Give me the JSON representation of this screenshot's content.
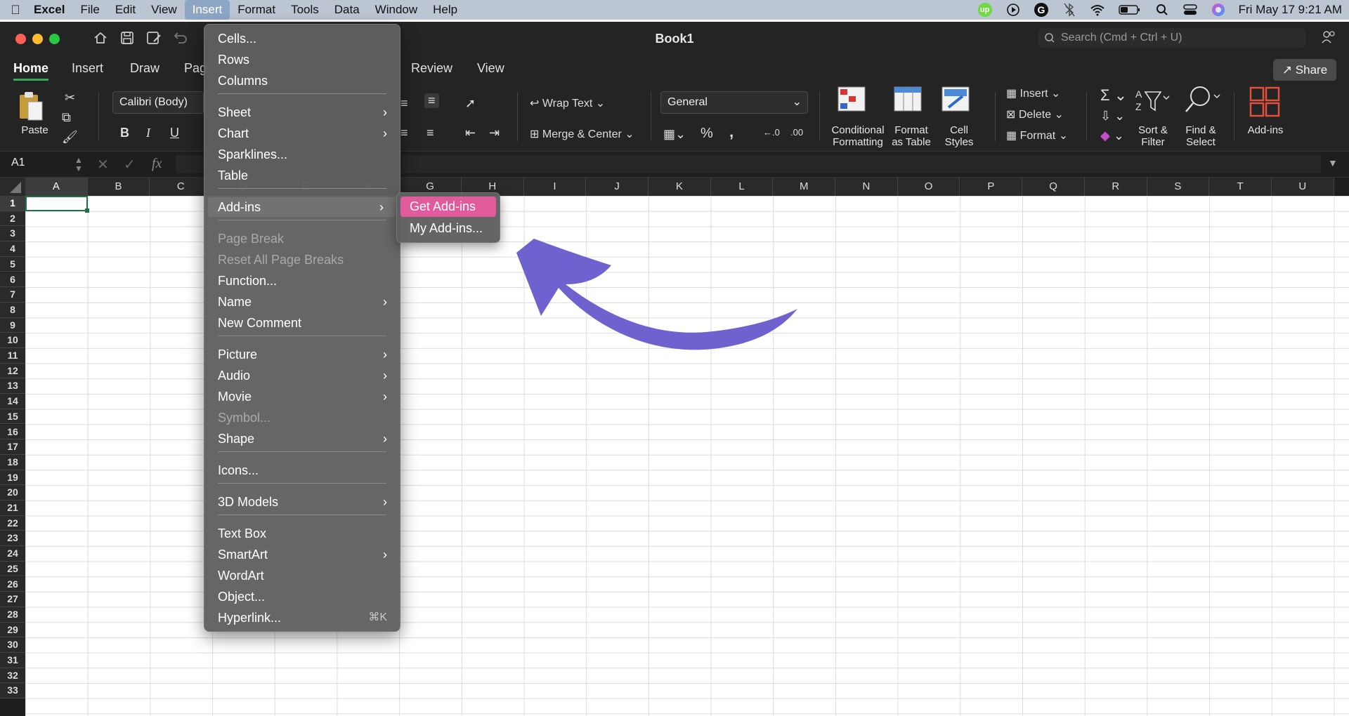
{
  "menubar": {
    "app": "Excel",
    "items": [
      "File",
      "Edit",
      "View",
      "Insert",
      "Format",
      "Tools",
      "Data",
      "Window",
      "Help"
    ],
    "active_item": "Insert",
    "clock": "Fri May 17  9:21 AM",
    "status_icons": [
      "upwork-icon",
      "play-icon",
      "grammarly-icon",
      "bluetooth-icon",
      "wifi-icon",
      "battery-icon",
      "search-icon",
      "control-center-icon",
      "siri-icon"
    ],
    "upwork_badge": "up"
  },
  "window": {
    "title": "Book1",
    "search_placeholder": "Search (Cmd + Ctrl + U)"
  },
  "tabs": {
    "items": [
      "Home",
      "Insert",
      "Draw",
      "Pag",
      "Review",
      "View"
    ],
    "active": "Home",
    "share_label": "Share"
  },
  "ribbon": {
    "paste": "Paste",
    "font_name": "Calibri (Body)",
    "bold": "B",
    "italic": "I",
    "underline": "U",
    "wrap_text": "Wrap Text",
    "merge_center": "Merge & Center",
    "number_format": "General",
    "percent": "%",
    "comma": ",",
    "conditional_formatting": [
      "Conditional",
      "Formatting"
    ],
    "format_as_table": [
      "Format",
      "as Table"
    ],
    "cell_styles": [
      "Cell",
      "Styles"
    ],
    "insert": "Insert",
    "delete": "Delete",
    "format": "Format",
    "sort_filter": [
      "Sort &",
      "Filter"
    ],
    "find_select": [
      "Find &",
      "Select"
    ],
    "add_ins": "Add-ins",
    "sigma": "Σ"
  },
  "formula_bar": {
    "name_box": "A1",
    "fx": "fx"
  },
  "grid": {
    "columns": [
      "A",
      "B",
      "C",
      "D",
      "E",
      "F",
      "G",
      "H",
      "I",
      "J",
      "K",
      "L",
      "M",
      "N",
      "O",
      "P",
      "Q",
      "R",
      "S",
      "T",
      "U"
    ],
    "rows": [
      "1",
      "2",
      "3",
      "4",
      "5",
      "6",
      "7",
      "8",
      "9",
      "10",
      "11",
      "12",
      "13",
      "14",
      "15",
      "16",
      "17",
      "18",
      "19",
      "20",
      "21",
      "22",
      "23",
      "24",
      "25",
      "26",
      "27",
      "28",
      "29",
      "30",
      "31",
      "32",
      "33"
    ],
    "selected_cell": "A1"
  },
  "insert_menu": {
    "items": [
      {
        "label": "Cells...",
        "submenu": false,
        "disabled": false
      },
      {
        "label": "Rows",
        "submenu": false,
        "disabled": false
      },
      {
        "label": "Columns",
        "submenu": false,
        "disabled": false
      },
      {
        "label": "Sheet",
        "submenu": true,
        "disabled": false
      },
      {
        "label": "Chart",
        "submenu": true,
        "disabled": false
      },
      {
        "label": "Sparklines...",
        "submenu": false,
        "disabled": false
      },
      {
        "label": "Table",
        "submenu": false,
        "disabled": false
      },
      {
        "label": "Add-ins",
        "submenu": true,
        "disabled": false,
        "highlighted": true
      },
      {
        "label": "Page Break",
        "submenu": false,
        "disabled": true
      },
      {
        "label": "Reset All Page Breaks",
        "submenu": false,
        "disabled": true
      },
      {
        "label": "Function...",
        "submenu": false,
        "disabled": false
      },
      {
        "label": "Name",
        "submenu": true,
        "disabled": false
      },
      {
        "label": "New Comment",
        "submenu": false,
        "disabled": false
      },
      {
        "label": "Picture",
        "submenu": true,
        "disabled": false
      },
      {
        "label": "Audio",
        "submenu": true,
        "disabled": false
      },
      {
        "label": "Movie",
        "submenu": true,
        "disabled": false
      },
      {
        "label": "Symbol...",
        "submenu": false,
        "disabled": true
      },
      {
        "label": "Shape",
        "submenu": true,
        "disabled": false
      },
      {
        "label": "Icons...",
        "submenu": false,
        "disabled": false
      },
      {
        "label": "3D Models",
        "submenu": true,
        "disabled": false
      },
      {
        "label": "Text Box",
        "submenu": false,
        "disabled": false
      },
      {
        "label": "SmartArt",
        "submenu": true,
        "disabled": false
      },
      {
        "label": "WordArt",
        "submenu": false,
        "disabled": false
      },
      {
        "label": "Object...",
        "submenu": false,
        "disabled": false
      },
      {
        "label": "Hyperlink...",
        "submenu": false,
        "disabled": false,
        "shortcut": "⌘K"
      }
    ]
  },
  "addins_submenu": {
    "items": [
      "Get Add-ins",
      "My Add-ins..."
    ],
    "highlighted": "Get Add-ins",
    "highlight_color": "#e15b9c"
  },
  "annotation": {
    "arrow_color": "#6f62cf"
  }
}
